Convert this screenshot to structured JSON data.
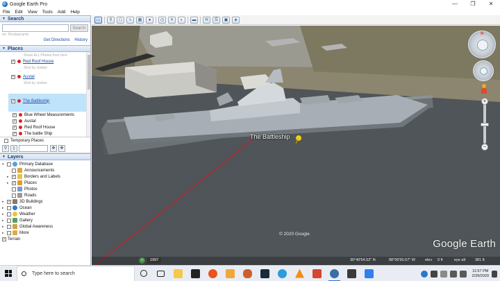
{
  "window": {
    "title": "Google Earth Pro",
    "controls": [
      "—",
      "❒",
      "✕"
    ]
  },
  "menu": [
    "File",
    "Edit",
    "View",
    "Tools",
    "Add",
    "Help"
  ],
  "search": {
    "header": "Search",
    "button": "Search",
    "hint": "ex: Restaurants",
    "get_directions": "Get Directions",
    "history": "History"
  },
  "places": {
    "header": "Places",
    "items": [
      {
        "label": "Share ALL Photos from here",
        "type": "grey"
      },
      {
        "label": "Red Roof House",
        "type": "link",
        "checked": true
      },
      {
        "label": "Shot by Jordan",
        "type": "grey"
      },
      {
        "label": "Austal",
        "type": "link",
        "checked": true
      },
      {
        "label": "Shot by Jordan",
        "type": "grey"
      },
      {
        "label": "The Battleship",
        "type": "link",
        "checked": true
      },
      {
        "label": "Blue Wheel Measurements",
        "type": "pin",
        "checked": true
      },
      {
        "label": "Austal",
        "type": "pin",
        "checked": true
      },
      {
        "label": "Red Roof House",
        "type": "pin",
        "checked": true
      },
      {
        "label": "The battle Ship",
        "type": "pin",
        "checked": true
      },
      {
        "label": "Temporary Places",
        "type": "folder",
        "checked": false
      }
    ]
  },
  "layers": {
    "header": "Layers",
    "items": [
      {
        "label": "Primary Database",
        "level": 0,
        "icon": "globe-icon",
        "checked": false
      },
      {
        "label": "Announcements",
        "level": 1,
        "icon": "announce-icon",
        "checked": false
      },
      {
        "label": "Borders and Labels",
        "level": 1,
        "icon": "borders-icon",
        "checked": true
      },
      {
        "label": "Places",
        "level": 1,
        "icon": "places-icon",
        "checked": true
      },
      {
        "label": "Photos",
        "level": 1,
        "icon": "photos-icon",
        "checked": false
      },
      {
        "label": "Roads",
        "level": 1,
        "icon": "roads-icon",
        "checked": false
      },
      {
        "label": "3D Buildings",
        "level": 1,
        "icon": "buildings-icon",
        "checked": true
      },
      {
        "label": "Ocean",
        "level": 1,
        "icon": "ocean-icon",
        "checked": false
      },
      {
        "label": "Weather",
        "level": 1,
        "icon": "weather-icon",
        "checked": false
      },
      {
        "label": "Gallery",
        "level": 1,
        "icon": "gallery-icon",
        "checked": false
      },
      {
        "label": "Global Awareness",
        "level": 1,
        "icon": "awareness-icon",
        "checked": false
      },
      {
        "label": "More",
        "level": 1,
        "icon": "more-icon",
        "checked": false
      },
      {
        "label": "Terrain",
        "level": 0,
        "icon": "",
        "checked": true
      }
    ]
  },
  "map": {
    "placemark_label": "The Battleship",
    "copyright": "© 2020 Google",
    "brand": "Google Earth",
    "history_year": "1997",
    "coords": "30°40'54.52\" N",
    "coords2": "88°00'50.67\" W",
    "elev": "elev",
    "elev_value": "0 ft",
    "eye_alt": "eye alt",
    "eye_alt_value": "381 ft",
    "nav_north": "N"
  },
  "taskbar": {
    "search_placeholder": "Type here to search",
    "time": "11:57 PM",
    "date": "2/29/2020"
  },
  "colors": {
    "water": "#4f5558",
    "ship": "#a7aeb5",
    "tour_line": "#b0283a",
    "pier": "#6d7274"
  }
}
